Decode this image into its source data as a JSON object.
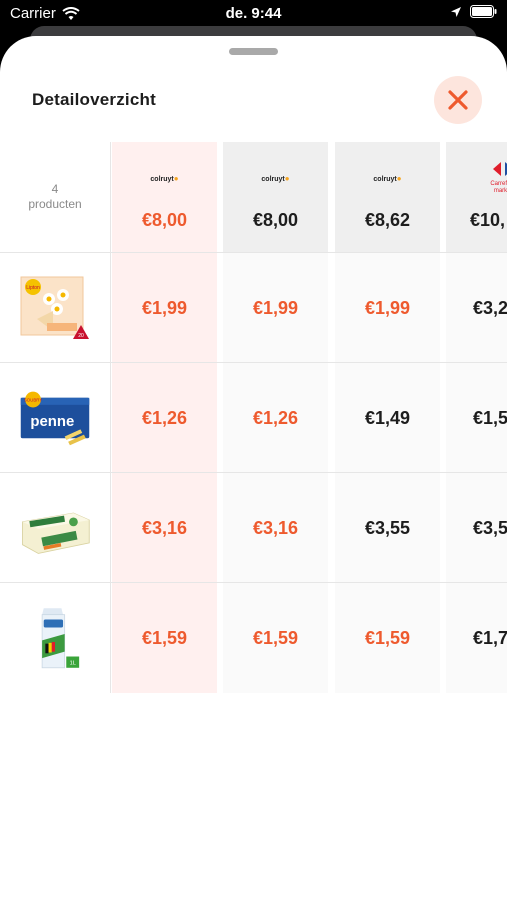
{
  "status_bar": {
    "carrier": "Carrier",
    "time": "de. 9:44"
  },
  "sheet": {
    "title": "Detailoverzicht"
  },
  "header": {
    "count_number": "4",
    "count_label": "producten",
    "stores": [
      {
        "name": "colruyt",
        "total": "€8,00",
        "best": true
      },
      {
        "name": "colruyt",
        "total": "€8,00",
        "best": false
      },
      {
        "name": "colruyt",
        "total": "€8,62",
        "best": false
      },
      {
        "name": "Carrefour market",
        "total": "€10,",
        "best": false
      }
    ]
  },
  "products": [
    {
      "image": "lipton-tea-box",
      "prices": [
        "€1,99",
        "€1,99",
        "€1,99",
        "€3,2"
      ],
      "best": [
        true,
        true,
        true,
        false
      ]
    },
    {
      "image": "soubry-penne-pack",
      "prices": [
        "€1,26",
        "€1,26",
        "€1,49",
        "€1,5"
      ],
      "best": [
        true,
        true,
        false,
        false
      ]
    },
    {
      "image": "carlsbourg-butter",
      "prices": [
        "€3,16",
        "€3,16",
        "€3,55",
        "€3,5"
      ],
      "best": [
        true,
        true,
        false,
        false
      ]
    },
    {
      "image": "milk-carton-1l",
      "prices": [
        "€1,59",
        "€1,59",
        "€1,59",
        "€1,7"
      ],
      "best": [
        true,
        true,
        true,
        false
      ]
    }
  ],
  "colors": {
    "accent": "#ee5a2e",
    "best_column_bg": "#fff0ef",
    "close_bg": "#fde5dd"
  }
}
